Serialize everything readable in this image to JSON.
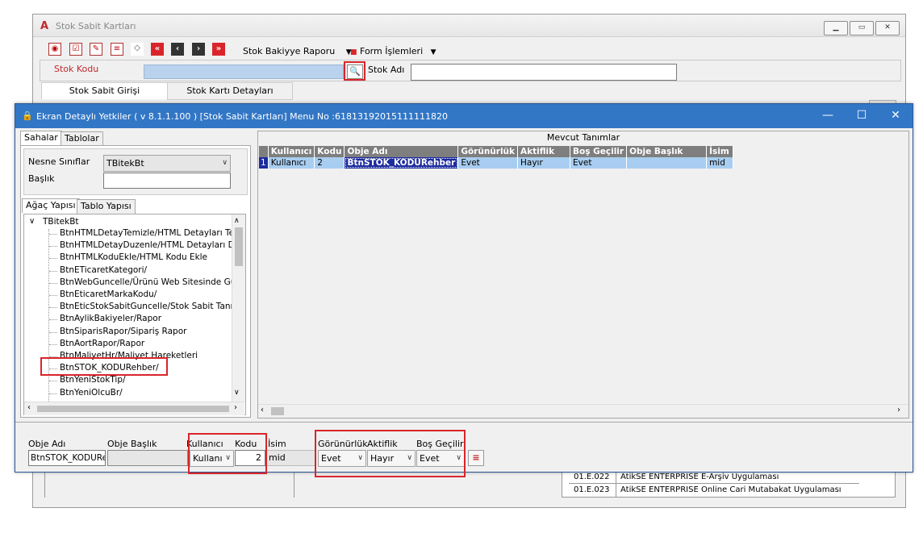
{
  "bg_window": {
    "title": "Stok Sabit Kartları",
    "menu_stok_bakiye": "Stok Bakiyye Raporu",
    "menu_form_islemleri": "Form İşlemleri",
    "stok_kodu_label": "Stok Kodu",
    "stok_adi_label": "Stok Adı",
    "tab_stok_sabit_girisi": "Stok Sabit Girişi",
    "tab_stok_karti_detaylari": "Stok Kartı Detayları",
    "bottom_rows": [
      {
        "code": "01.E.022",
        "name": "AtikSE ENTERPRISE E-Arşiv Uygulaması"
      },
      {
        "code": "01.E.023",
        "name": "AtikSE ENTERPRISE Online Cari Mutabakat Uygulaması"
      }
    ]
  },
  "dialog": {
    "title": "Ekran Detaylı Yetkiler ( v 8.1.1.100 ) [Stok Sabit Kartları] Menu No :61813192015111111820",
    "tabs_top": [
      "Sahalar",
      "Tablolar"
    ],
    "nesne_siniflar_label": "Nesne Sınıflar",
    "nesne_siniflar_value": "TBitekBt",
    "baslik_label": "Başlık",
    "baslik_value": "",
    "tabs_tree": [
      "Ağaç Yapısı",
      "Tablo Yapısı"
    ],
    "tree_root": "TBitekBt",
    "tree_items": [
      "BtnHTMLDetayTemizle/HTML Detayları Temizle",
      "BtnHTMLDetayDuzenle/HTML Detayları Düzenl",
      "BtnHTMLKoduEkle/HTML Kodu Ekle",
      "BtnETicaretKategori/",
      "BtnWebGuncelle/Ürünü Web Sitesinde Güncelle",
      "BtnEticaretMarkaKodu/",
      "BtnEticStokSabitGuncelle/Stok Sabit Tanımlama",
      "BtnAylikBakiyeler/Rapor",
      "BtnSiparisRapor/Sipariş Rapor",
      "BtnAortRapor/Rapor",
      "BtnMaliyetHr/Maliyet Hareketleri",
      "BtnSTOK_KODURehber/",
      "BtnYeniStokTip/",
      "BtnYeniOlcuBr/"
    ],
    "grid_title": "Mevcut Tanımlar",
    "grid_headers": [
      "Kullanıcı",
      "Kodu",
      "Obje Adı",
      "Görünürlük",
      "Aktiflik",
      "Boş Geçilir",
      "Obje Başlık",
      "İsim"
    ],
    "grid_rows": [
      {
        "num": "1",
        "kullanici": "Kullanıcı",
        "kodu": "2",
        "obje_adi": "BtnSTOK_KODURehber",
        "gorunurluk": "Evet",
        "aktiflik": "Hayır",
        "bos_gecilir": "Evet",
        "obje_baslik": "",
        "isim": "mid"
      }
    ],
    "form": {
      "obje_adi_label": "Obje Adı",
      "obje_adi_value": "BtnSTOK_KODUReh",
      "obje_baslik_label": "Obje Başlık",
      "obje_baslik_value": "",
      "kullanici_label": "Kullanıcı",
      "kullanici_value": "Kullanı",
      "kodu_label": "Kodu",
      "kodu_value": "2",
      "isim_label": "İsim",
      "isim_value": "mid",
      "gorunurluk_label": "Görünürlük",
      "gorunurluk_value": "Evet",
      "aktiflik_label": "Aktiflik",
      "aktiflik_value": "Hayır",
      "bos_gecilir_label": "Boş Geçilir",
      "bos_gecilir_value": "Evet"
    }
  },
  "colors": {
    "accent_blue": "#3277c6",
    "grid_header": "#7e7e7e",
    "grid_row": "#a8cdf0",
    "highlight_red": "#d9252a"
  }
}
